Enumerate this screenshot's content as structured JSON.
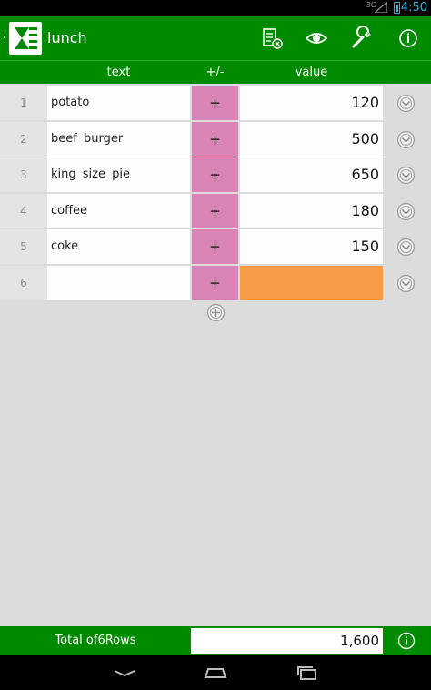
{
  "status": {
    "network": "3G",
    "time": "4:50"
  },
  "app": {
    "title": "lunch",
    "accent": "#008a00"
  },
  "toolbar": {
    "icons": [
      "clear-sheet-icon",
      "eye-icon",
      "wrench-icon",
      "info-icon"
    ]
  },
  "columns": {
    "text": "text",
    "pm": "+/-",
    "value": "value"
  },
  "rows": [
    {
      "num": "1",
      "text": "potato",
      "pm": "+",
      "value": "120"
    },
    {
      "num": "2",
      "text": "beef burger",
      "pm": "+",
      "value": "500"
    },
    {
      "num": "3",
      "text": "king size pie",
      "pm": "+",
      "value": "650"
    },
    {
      "num": "4",
      "text": "coffee",
      "pm": "+",
      "value": "180"
    },
    {
      "num": "5",
      "text": "coke",
      "pm": "+",
      "value": "150"
    },
    {
      "num": "6",
      "text": "",
      "pm": "+",
      "value": ""
    }
  ],
  "footer": {
    "label": "Total of6Rows",
    "total": "1,600"
  },
  "colors": {
    "pm_cell": "#d984b4",
    "empty_value": "#f79b44"
  }
}
